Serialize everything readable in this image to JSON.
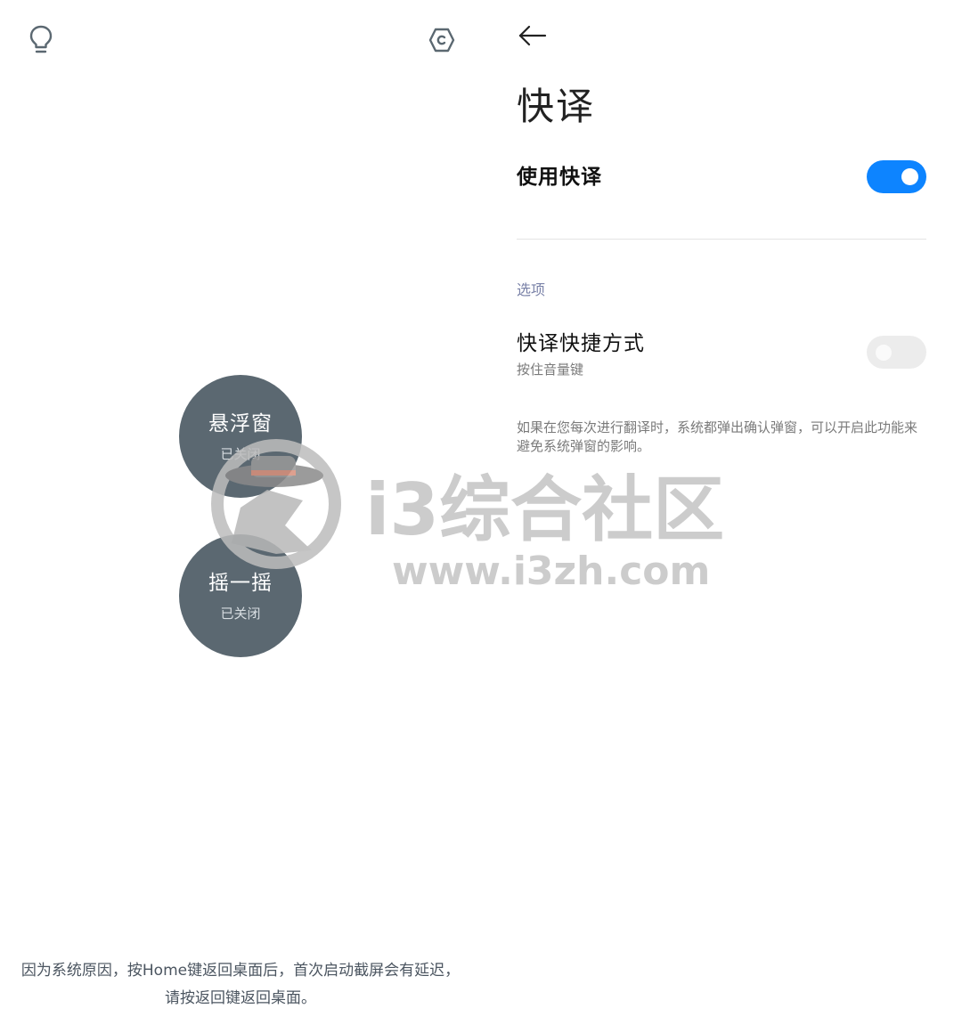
{
  "left": {
    "icons": {
      "bulb": "lightbulb-icon",
      "settings": "settings-hexagon-icon"
    },
    "buttons": [
      {
        "title": "悬浮窗",
        "status": "已关闭"
      },
      {
        "title": "摇一摇",
        "status": "已关闭"
      }
    ],
    "note": "因为系统原因，按Home键返回桌面后，首次启动截屏会有延迟，请按返回键返回桌面。"
  },
  "right": {
    "back_icon": "back-arrow-icon",
    "title": "快译",
    "use_label": "使用快译",
    "use_enabled": true,
    "section_label": "选项",
    "shortcut_label": "快译快捷方式",
    "shortcut_sub": "按住音量键",
    "shortcut_enabled": false,
    "description": "如果在您每次进行翻译时，系统都弹出确认弹窗，可以开启此功能来避免系统弹窗的影响。"
  },
  "watermark": {
    "text": "i3综合社区",
    "url": "www.i3zh.com"
  },
  "colors": {
    "toggle_on": "#0d84ff",
    "toggle_off": "#ececec",
    "circle_bg": "#5b6871",
    "section_label": "#7a82a8"
  }
}
